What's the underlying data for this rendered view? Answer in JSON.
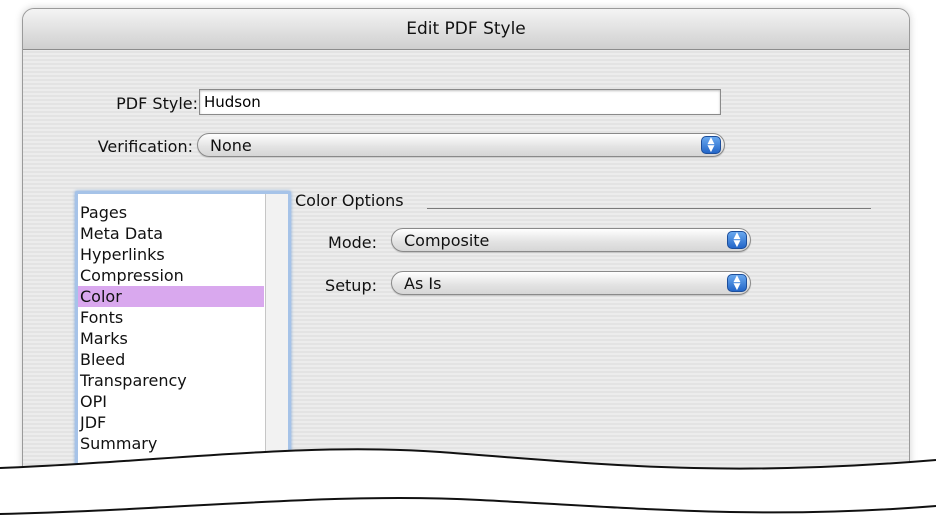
{
  "window": {
    "title": "Edit PDF Style"
  },
  "fields": {
    "pdf_style_label": "PDF Style:",
    "pdf_style_value": "Hudson",
    "verification_label": "Verification:",
    "verification_value": "None"
  },
  "categories": [
    "Pages",
    "Meta Data",
    "Hyperlinks",
    "Compression",
    "Color",
    "Fonts",
    "Marks",
    "Bleed",
    "Transparency",
    "OPI",
    "JDF",
    "Summary"
  ],
  "selected_category": "Color",
  "color_options": {
    "group_title": "Color Options",
    "mode_label": "Mode:",
    "mode_value": "Composite",
    "setup_label": "Setup:",
    "setup_value": "As Is"
  },
  "colors": {
    "selection": "#d9a8ee",
    "focus_ring": "#a6c3e8",
    "stepper": "#2366c8"
  }
}
